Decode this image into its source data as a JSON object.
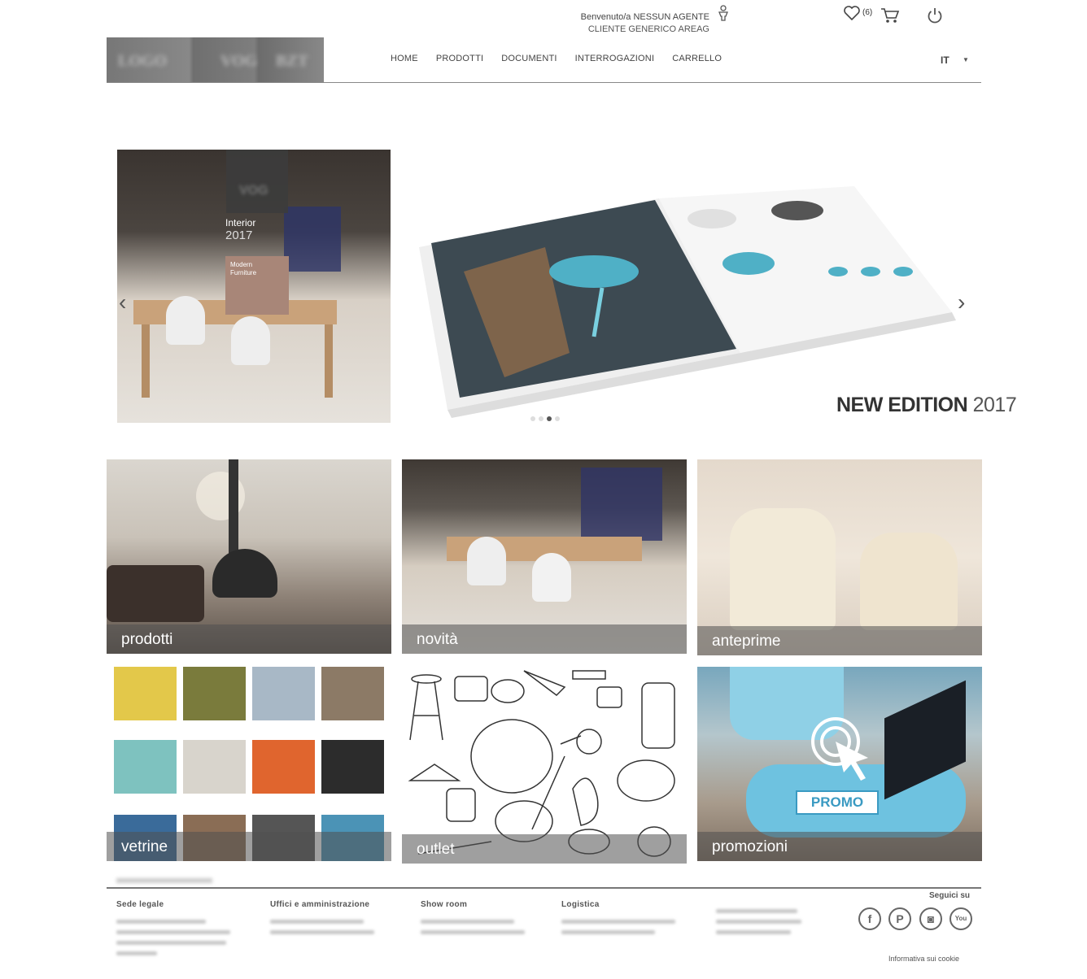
{
  "header": {
    "welcome_line1": "Benvenuto/a NESSUN AGENTE",
    "welcome_line2": "CLIENTE GENERICO AREAG",
    "wishlist_count": "(6)",
    "icons": [
      "user-icon",
      "heart-icon",
      "cart-icon",
      "power-icon"
    ],
    "language": "IT"
  },
  "nav": {
    "items": [
      "HOME",
      "PRODOTTI",
      "DOCUMENTI",
      "INTERROGAZIONI",
      "CARRELLO"
    ]
  },
  "slider": {
    "left_slide": {
      "title": "Interior",
      "year": "2017",
      "box_line1": "Modern",
      "box_line2": "Furniture"
    },
    "main_slide": {
      "caption_bold": "NEW EDITION",
      "caption_year": "2017"
    },
    "dots": 4,
    "active_dot": 2
  },
  "tiles": [
    {
      "label": "prodotti"
    },
    {
      "label": "novità"
    },
    {
      "label": "anteprime"
    },
    {
      "label": "vetrine"
    },
    {
      "label": "outlet"
    },
    {
      "label": "promozioni"
    }
  ],
  "promo_badge": "PROMO",
  "footer": {
    "columns": [
      "Sede legale",
      "Uffici e amministrazione",
      "Show room",
      "Logistica"
    ],
    "follow_label": "Seguici su",
    "cookie_label": "Informativa sui cookie",
    "social": [
      {
        "name": "facebook-icon",
        "glyph": "f"
      },
      {
        "name": "pinterest-icon",
        "glyph": "P"
      },
      {
        "name": "instagram-icon",
        "glyph": "◙"
      },
      {
        "name": "youtube-icon",
        "glyph": "You"
      }
    ]
  }
}
